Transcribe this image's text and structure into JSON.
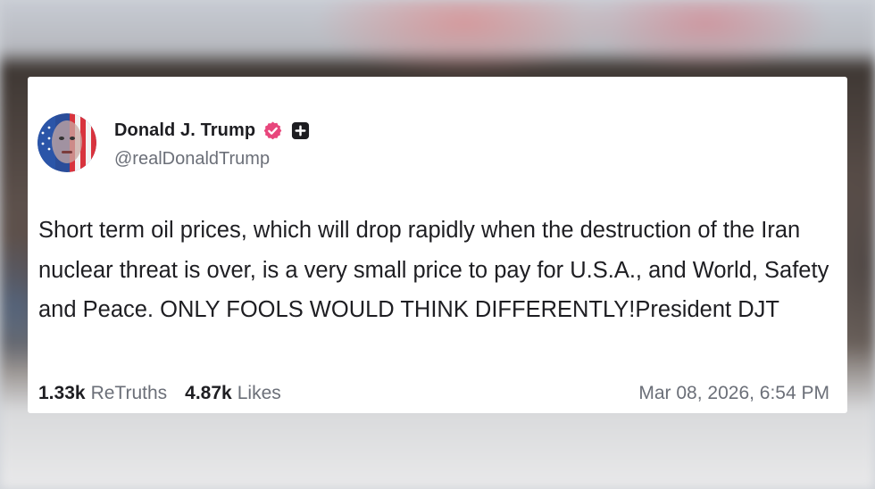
{
  "post": {
    "display_name": "Donald J. Trump",
    "handle": "@realDonaldTrump",
    "text": "Short term oil prices, which will drop rapidly when the destruction of the Iran nuclear threat is over, is a very small price to pay for U.S.A., and World, Safety and Peace. ONLY FOOLS WOULD THINK DIFFERENTLY!President DJT",
    "retruths_count": "1.33k",
    "retruths_label": "ReTruths",
    "likes_count": "4.87k",
    "likes_label": "Likes",
    "timestamp": "Mar 08, 2026, 6:54 PM"
  },
  "icons": {
    "verified": "verified-badge-icon",
    "plus": "plus-square-icon",
    "avatar": "avatar-flag-portrait"
  },
  "colors": {
    "verified_badge": "#e8467c",
    "card_background": "#ffffff",
    "name_text": "#1d1d21",
    "secondary_text": "#6b6f78"
  }
}
